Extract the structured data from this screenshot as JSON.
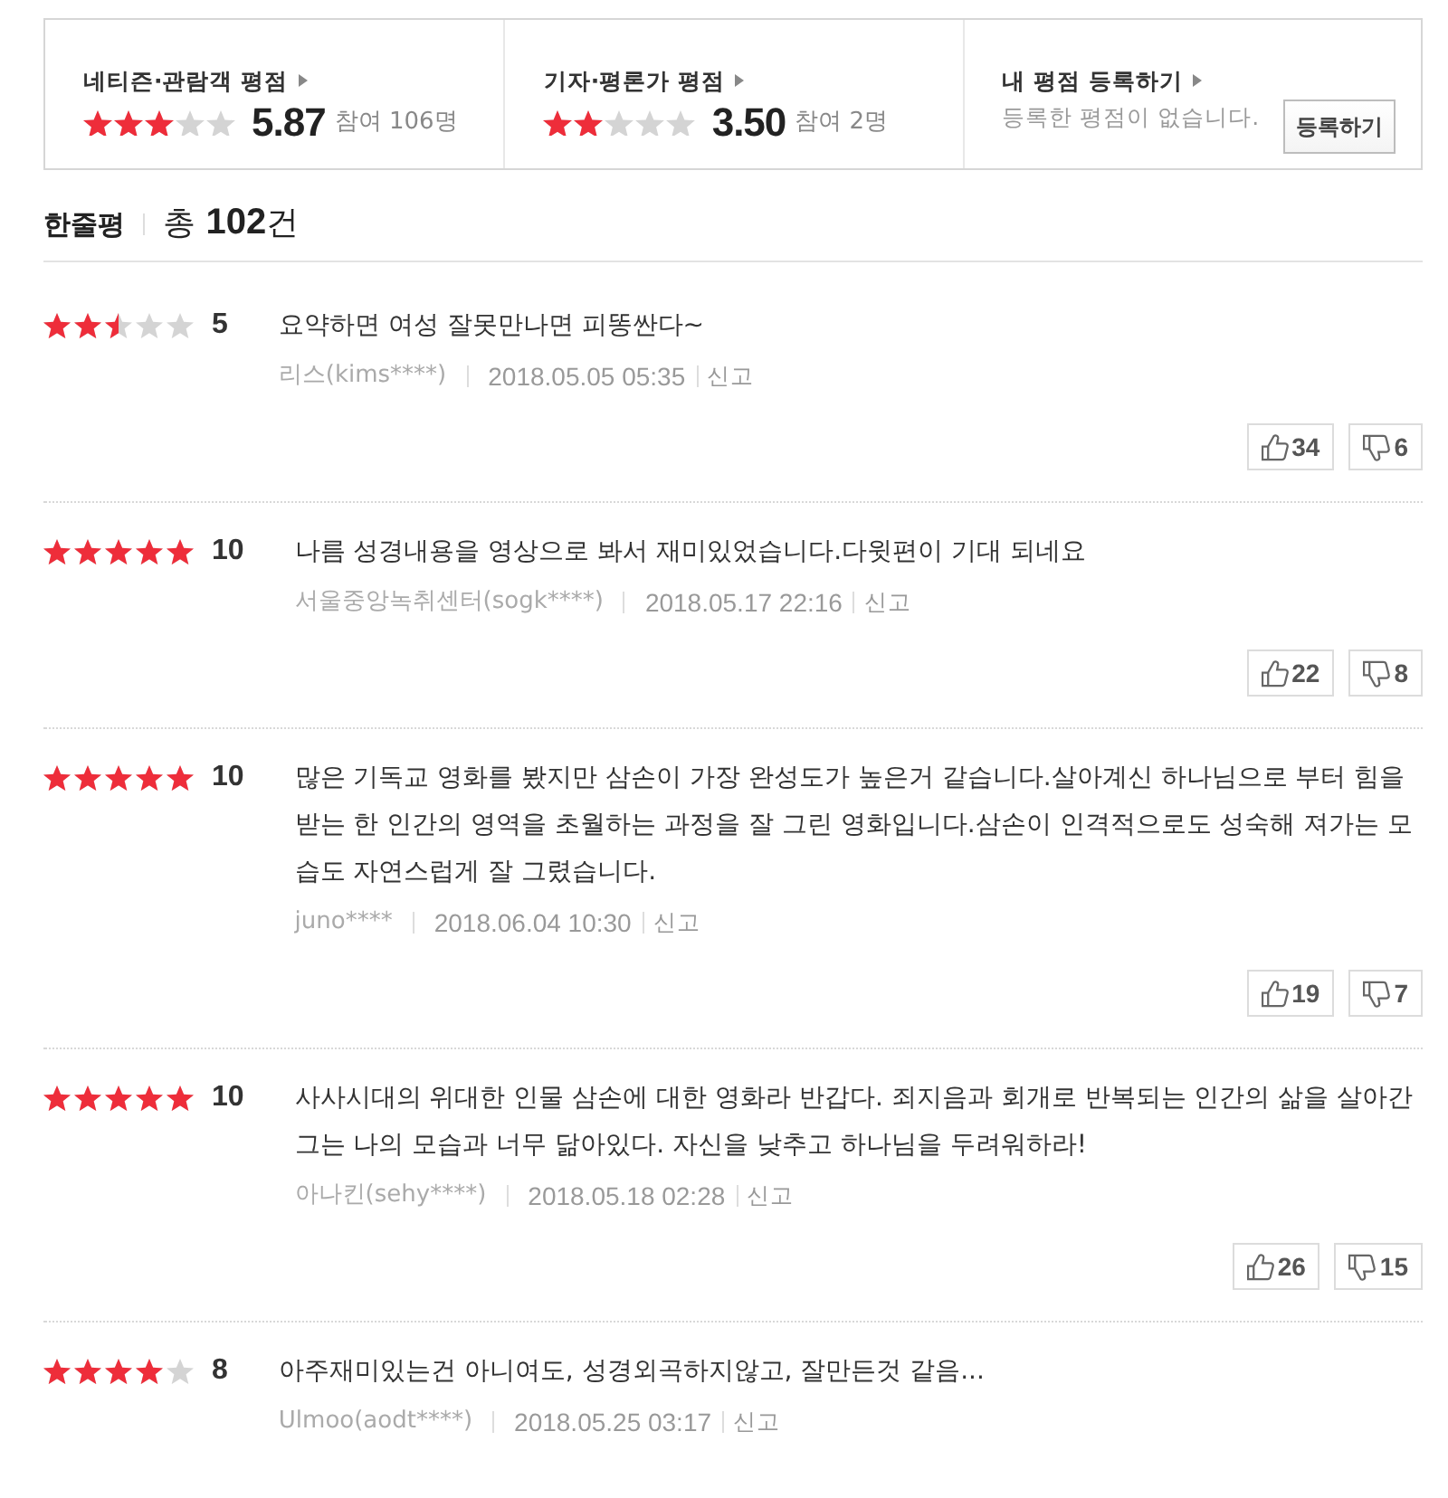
{
  "rating_summary": [
    {
      "kind": "rating",
      "title": "네티즌·관람객 평점",
      "stars": 3,
      "score": "5.87",
      "participants": "참여 106명"
    },
    {
      "kind": "rating",
      "title": "기자·평론가 평점",
      "stars": 2,
      "score": "3.50",
      "participants": "참여 2명"
    },
    {
      "kind": "register",
      "title": "내 평점 등록하기",
      "message": "등록한 평점이 없습니다.",
      "button": "등록하기"
    }
  ],
  "reviews_header": {
    "title": "한줄평",
    "total": "총 **102**건"
  },
  "reviews": [
    {
      "stars": 2.5,
      "score": "5",
      "text": "요약하면 여성 잘못만나면 피똥싼다~",
      "author": "리스(kims****)",
      "date": "2018.05.05 05:35",
      "report": "신고",
      "likes": "34",
      "dislikes": "6"
    },
    {
      "stars": 5,
      "score": "10",
      "text": "나름 성경내용을 영상으로 봐서 재미있었습니다.다윗편이 기대 되네요",
      "author": "서울중앙녹취센터(sogk****)",
      "date": "2018.05.17 22:16",
      "report": "신고",
      "likes": "22",
      "dislikes": "8"
    },
    {
      "stars": 5,
      "score": "10",
      "text": "많은 기독교 영화를 봤지만 삼손이 가장 완성도가 높은거 같습니다.살아계신 하나님으로 부터 힘을 받는 한 인간의 영역을 초월하는 과정을 잘 그린 영화입니다.삼손이 인격적으로도 성숙해 져가는 모습도 자연스럽게 잘 그렸습니다.",
      "author": "juno****",
      "date": "2018.06.04 10:30",
      "report": "신고",
      "likes": "19",
      "dislikes": "7"
    },
    {
      "stars": 5,
      "score": "10",
      "text": "사사시대의 위대한 인물 삼손에 대한 영화라 반갑다. 죄지음과 회개로 반복되는 인간의 삶을 살아간 그는 나의 모습과 너무 닮아있다. 자신을 낮추고 하나님을 두려워하라!",
      "author": "아나킨(sehy****)",
      "date": "2018.05.18 02:28",
      "report": "신고",
      "likes": "26",
      "dislikes": "15"
    },
    {
      "stars": 4,
      "score": "8",
      "text": "아주재미있는건 아니여도, 성경외곡하지않고, 잘만든것 같음...",
      "author": "Ulmoo(aodt****)",
      "date": "2018.05.25 03:17",
      "report": "신고"
    }
  ]
}
